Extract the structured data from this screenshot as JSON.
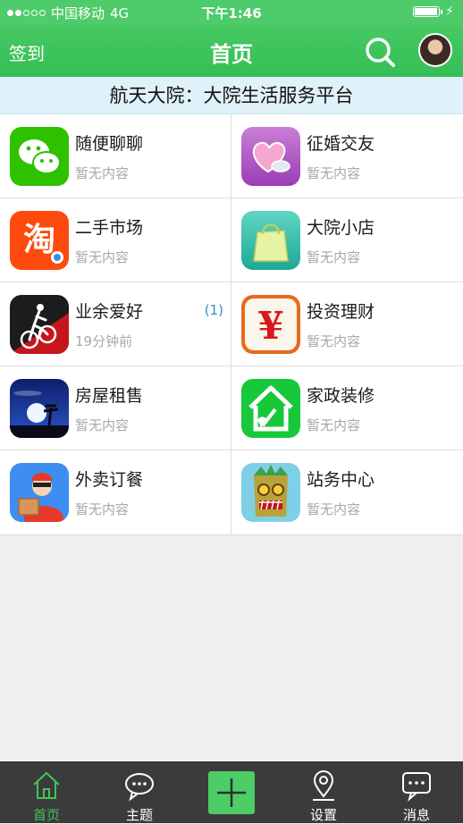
{
  "status": {
    "carrier": "中国移动",
    "network": "4G",
    "time": "下午1:46"
  },
  "nav": {
    "left_label": "签到",
    "title": "首页"
  },
  "banner": {
    "text": "航天大院：大院生活服务平台"
  },
  "grid": {
    "items": [
      {
        "title": "随便聊聊",
        "subtitle": "暂无内容",
        "badge": "",
        "icon": "wechat-icon"
      },
      {
        "title": "征婚交友",
        "subtitle": "暂无内容",
        "badge": "",
        "icon": "heart-icon"
      },
      {
        "title": "二手市场",
        "subtitle": "暂无内容",
        "badge": "",
        "icon": "taobao-icon"
      },
      {
        "title": "大院小店",
        "subtitle": "暂无内容",
        "badge": "",
        "icon": "shopping-bag-icon"
      },
      {
        "title": "业余爱好",
        "subtitle": "19分钟前",
        "badge": "(1)",
        "icon": "cyclist-icon"
      },
      {
        "title": "投资理财",
        "subtitle": "暂无内容",
        "badge": "",
        "icon": "yen-icon"
      },
      {
        "title": "房屋租售",
        "subtitle": "暂无内容",
        "badge": "",
        "icon": "moon-night-icon"
      },
      {
        "title": "家政装修",
        "subtitle": "暂无内容",
        "badge": "",
        "icon": "house-broom-icon"
      },
      {
        "title": "外卖订餐",
        "subtitle": "暂无内容",
        "badge": "",
        "icon": "delivery-man-icon"
      },
      {
        "title": "站务中心",
        "subtitle": "暂无内容",
        "badge": "",
        "icon": "tiki-mask-icon"
      }
    ]
  },
  "tabs": [
    {
      "label": "首页",
      "icon": "home-icon",
      "active": true
    },
    {
      "label": "主题",
      "icon": "chat-bubble-icon",
      "active": false
    },
    {
      "label": "",
      "icon": "plus-icon",
      "active": false
    },
    {
      "label": "设置",
      "icon": "location-pin-icon",
      "active": false
    },
    {
      "label": "消息",
      "icon": "message-icon",
      "active": false
    }
  ],
  "colors": {
    "accent_green": "#3fc65e",
    "banner_bg": "#dff1f9",
    "tab_bar_bg": "#3b3b3b",
    "badge_blue": "#2a8fd4"
  },
  "battery_level": 0.9
}
